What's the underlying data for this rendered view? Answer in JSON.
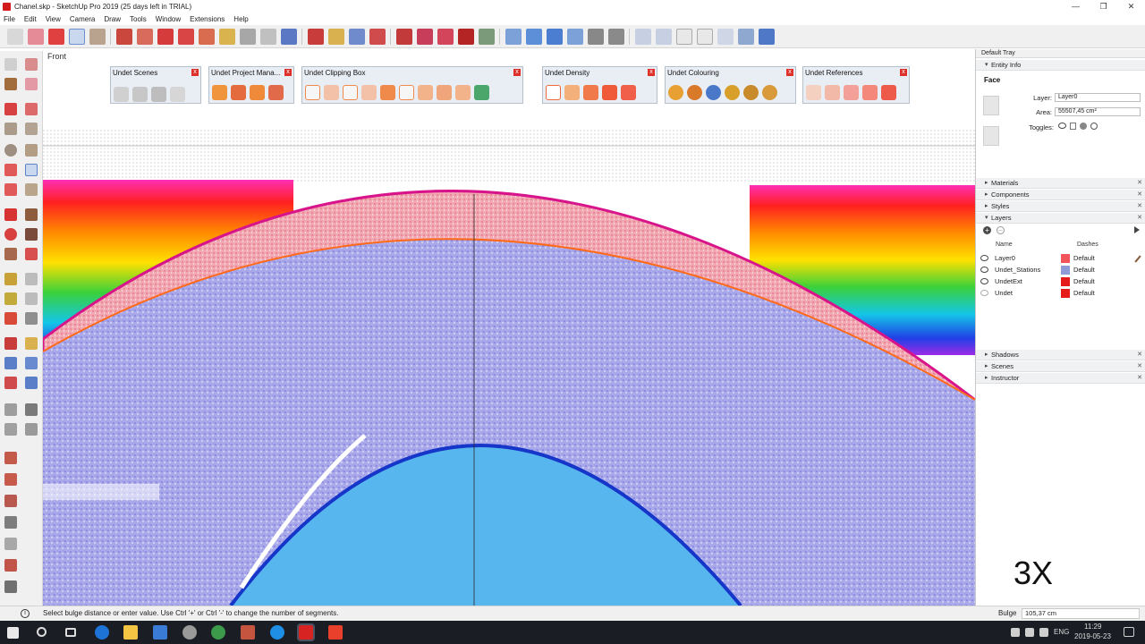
{
  "window": {
    "title": "Chanel.skp - SketchUp Pro 2019 (25 days left in TRIAL)",
    "controls": [
      "—",
      "❐",
      "✕"
    ]
  },
  "menu": [
    "File",
    "Edit",
    "View",
    "Camera",
    "Draw",
    "Tools",
    "Window",
    "Extensions",
    "Help"
  ],
  "viewport": {
    "scene_label": "Front",
    "overlay_text": "3X"
  },
  "panels": {
    "scenes": "Undet Scenes",
    "project_manager": "Undet Project Mana...",
    "clipping_box": "Undet Clipping Box",
    "density": "Undet Density",
    "colouring": "Undet Colouring",
    "references": "Undet References",
    "close_glyph": "x"
  },
  "tray": {
    "title": "Default Tray",
    "entity_info": {
      "section": "Entity Info",
      "face_label": "Face",
      "layer_label": "Layer:",
      "layer_value": "Layer0",
      "area_label": "Area:",
      "area_value": "55507,45 cm²",
      "toggles_label": "Toggles:"
    },
    "sections_mid": [
      "Materials",
      "Components",
      "Styles"
    ],
    "layers": {
      "section": "Layers",
      "col_name": "Name",
      "col_dashes": "Dashes",
      "rows": [
        {
          "name": "Layer0",
          "dashes": "Default",
          "color": "#f2545c",
          "visible": true
        },
        {
          "name": "Undet_Stations",
          "dashes": "Default",
          "color": "#8f9bd6",
          "visible": true
        },
        {
          "name": "UndetExt",
          "dashes": "Default",
          "color": "#e51b1b",
          "visible": true
        },
        {
          "name": "Undet",
          "dashes": "Default",
          "color": "#e51b1b",
          "visible": false
        }
      ]
    },
    "sections_bottom": [
      "Shadows",
      "Scenes",
      "Instructor"
    ]
  },
  "status": {
    "info_glyph": "i",
    "text": "Select bulge distance or enter value. Use Ctrl '+' or Ctrl '-' to change the number of segments.",
    "vcb_label": "Bulge",
    "vcb_value": "105,37 cm"
  },
  "taskbar": {
    "lang": "ENG",
    "time": "11:29",
    "date": "2019-05-23"
  }
}
